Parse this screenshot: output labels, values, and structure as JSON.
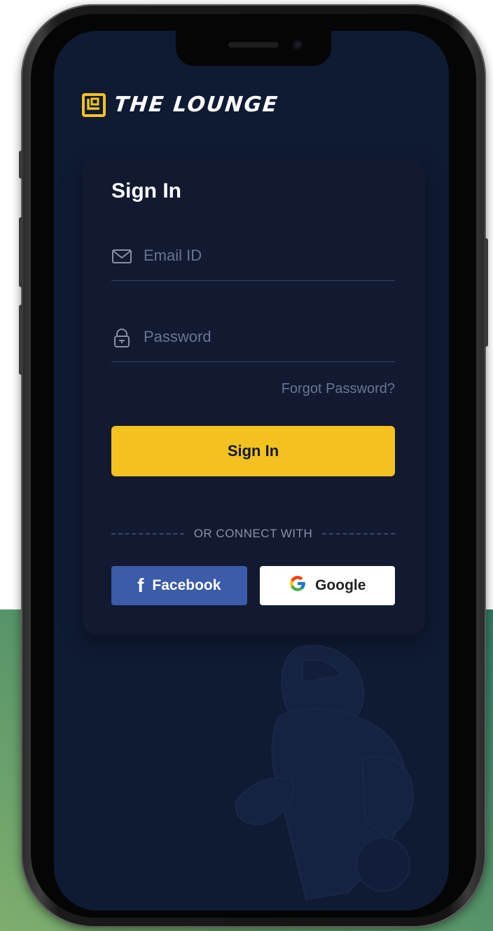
{
  "brand": {
    "name": "THE LOUNGE",
    "accent_color": "#f4c21f"
  },
  "colors": {
    "screen_background": "#0f1a33",
    "card_background": "#111a31",
    "primary_button": "#f4c21f",
    "facebook_blue": "#3c5ba8",
    "backdrop_green": "#4e8a6a"
  },
  "signin": {
    "title": "Sign In",
    "email": {
      "icon": "mail-icon",
      "placeholder": "Email ID",
      "value": ""
    },
    "password": {
      "icon": "lock-icon",
      "placeholder": "Password",
      "value": ""
    },
    "forgot_label": "Forgot Password?",
    "submit_label": "Sign In",
    "divider_label": "OR CONNECT WITH",
    "social": {
      "facebook_label": "Facebook",
      "facebook_icon": "facebook-icon",
      "google_label": "Google",
      "google_icon": "google-icon"
    }
  }
}
